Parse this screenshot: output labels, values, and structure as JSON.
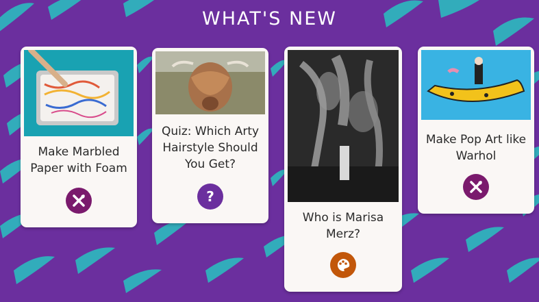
{
  "header": {
    "title": "WHAT'S NEW"
  },
  "cards": [
    {
      "label": "Make Marbled Paper with Foam",
      "image": "marbled-paper-tray-photo",
      "icon": "craft-tools-icon",
      "icon_color": "#7a1a6d"
    },
    {
      "label": "Quiz: Which Arty Hairstyle Should You Get?",
      "image": "highland-cow-photo",
      "icon": "question-icon",
      "icon_color": "#6b2f9e"
    },
    {
      "label": "Who is Marisa Merz?",
      "image": "marisa-merz-sculpture-photo",
      "icon": "palette-icon",
      "icon_color": "#c2570a"
    },
    {
      "label": "Make Pop Art like Warhol",
      "image": "warhol-banana-illustration",
      "icon": "craft-tools-icon",
      "icon_color": "#7a1a6d"
    }
  ],
  "colors": {
    "background": "#6b2f9e",
    "strokes": "#2fb3bd",
    "card": "#faf7f5"
  }
}
